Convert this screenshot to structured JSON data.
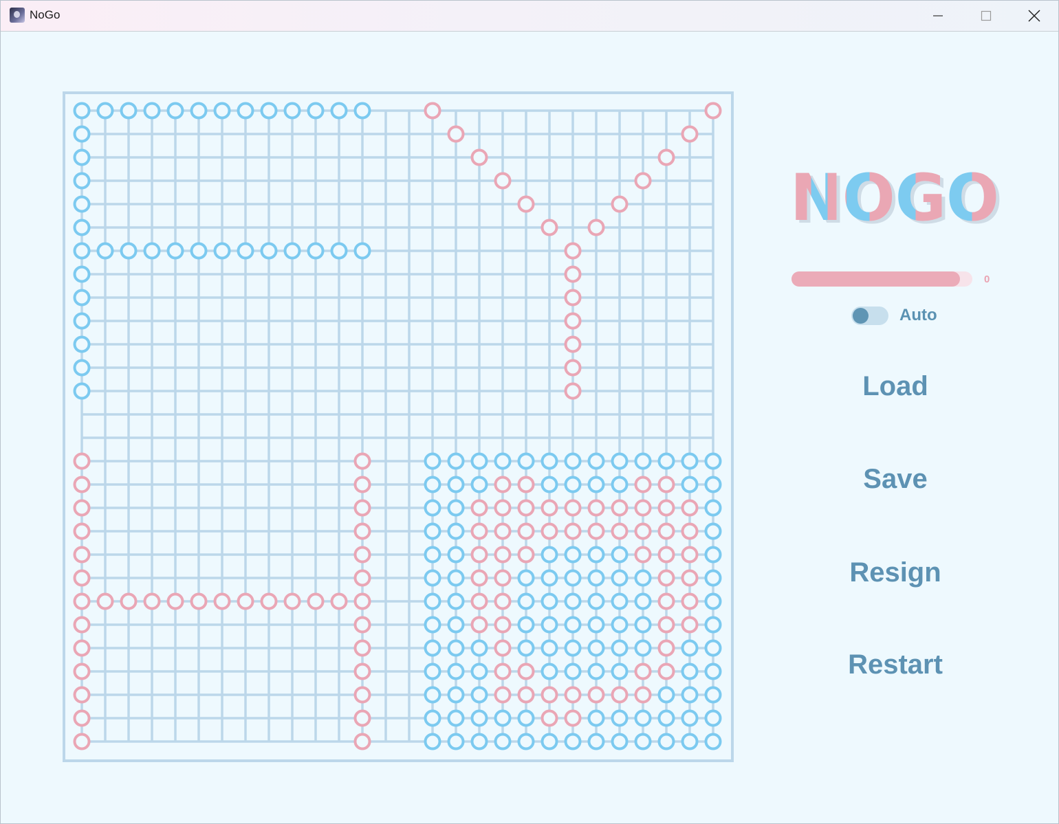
{
  "window": {
    "title": "NoGo",
    "icons": {
      "app": "app-icon",
      "minimize": "minimize-icon",
      "maximize": "maximize-icon",
      "close": "close-icon"
    }
  },
  "colors": {
    "background": "#eef9fe",
    "grid": "#bcd7ea",
    "blue_piece": "#7ccaf0",
    "pink_piece": "#eaa6b5",
    "text": "#5d92b3"
  },
  "board": {
    "size": 28,
    "pieces": {
      "blue": "0,0 0,1 0,2 0,3 0,4 0,5 0,6 0,7 0,8 0,9 0,10 0,11 0,12 1,0 2,0 3,0 4,0 5,0 6,0 6,1 6,2 6,3 6,4 6,5 6,6 6,7 6,8 6,9 6,10 6,11 6,12 7,0 8,0 9,0 10,0 11,0 12,0 15,15 15,16 15,17 15,18 15,19 15,20 15,21 15,22 15,23 15,24 15,25 15,26 15,27 16,15 16,16 16,17 16,20 16,21 16,22 16,23 16,26 16,27 17,15 17,16 17,27 18,15 18,16 18,27 19,15 19,16 19,20 19,21 19,22 19,23 19,27 20,15 20,16 20,19 20,20 20,21 20,22 20,23 20,24 20,27 21,15 21,16 21,19 21,20 21,21 21,22 21,23 21,24 21,27 22,15 22,16 22,19 22,20 22,21 22,22 22,23 22,24 22,27 23,15 23,16 23,17 23,19 23,20 23,21 23,22 23,23 23,24 23,26 23,27 24,15 24,16 24,17 24,20 24,21 24,22 24,23 24,26 24,27 25,15 25,16 25,17 25,25 25,26 25,27 26,15 26,16 26,17 26,18 26,19 26,22 26,23 26,24 26,25 26,26 26,27 27,15 27,16 27,17 27,18 27,19 27,20 27,21 27,22 27,23 27,24 27,25 27,26 27,27",
      "pink": "0,15 1,16 2,17 3,18 4,19 5,20 6,21 7,21 8,21 9,21 10,21 11,21 12,21 5,22 4,23 3,24 2,25 1,26 0,27 15,0 16,0 17,0 18,0 19,0 20,0 21,0 22,0 23,0 24,0 25,0 26,0 27,0 21,1 21,2 21,3 21,4 21,5 21,6 21,7 21,8 21,9 21,10 21,11 15,12 16,12 17,12 18,12 19,12 20,12 21,12 22,12 23,12 24,12 25,12 26,12 27,12 16,18 16,19 16,24 16,25 17,17 17,18 17,19 17,20 17,21 17,22 17,23 17,24 17,25 17,26 18,17 18,18 18,19 18,20 18,21 18,22 18,23 18,24 18,25 18,26 19,17 19,18 19,19 19,24 19,25 19,26 20,17 20,18 20,25 20,26 21,17 21,18 21,25 21,26 22,17 22,18 22,25 22,26 23,18 23,25 24,18 24,19 24,24 24,25 25,18 25,19 25,20 25,21 25,22 25,23 25,24 26,20 26,21"
    }
  },
  "logo": {
    "text": "NOGO"
  },
  "progress": {
    "fraction": 0.93,
    "value": "0"
  },
  "auto_toggle": {
    "label": "Auto",
    "on": false
  },
  "menu": {
    "load": "Load",
    "save": "Save",
    "resign": "Resign",
    "restart": "Restart"
  }
}
